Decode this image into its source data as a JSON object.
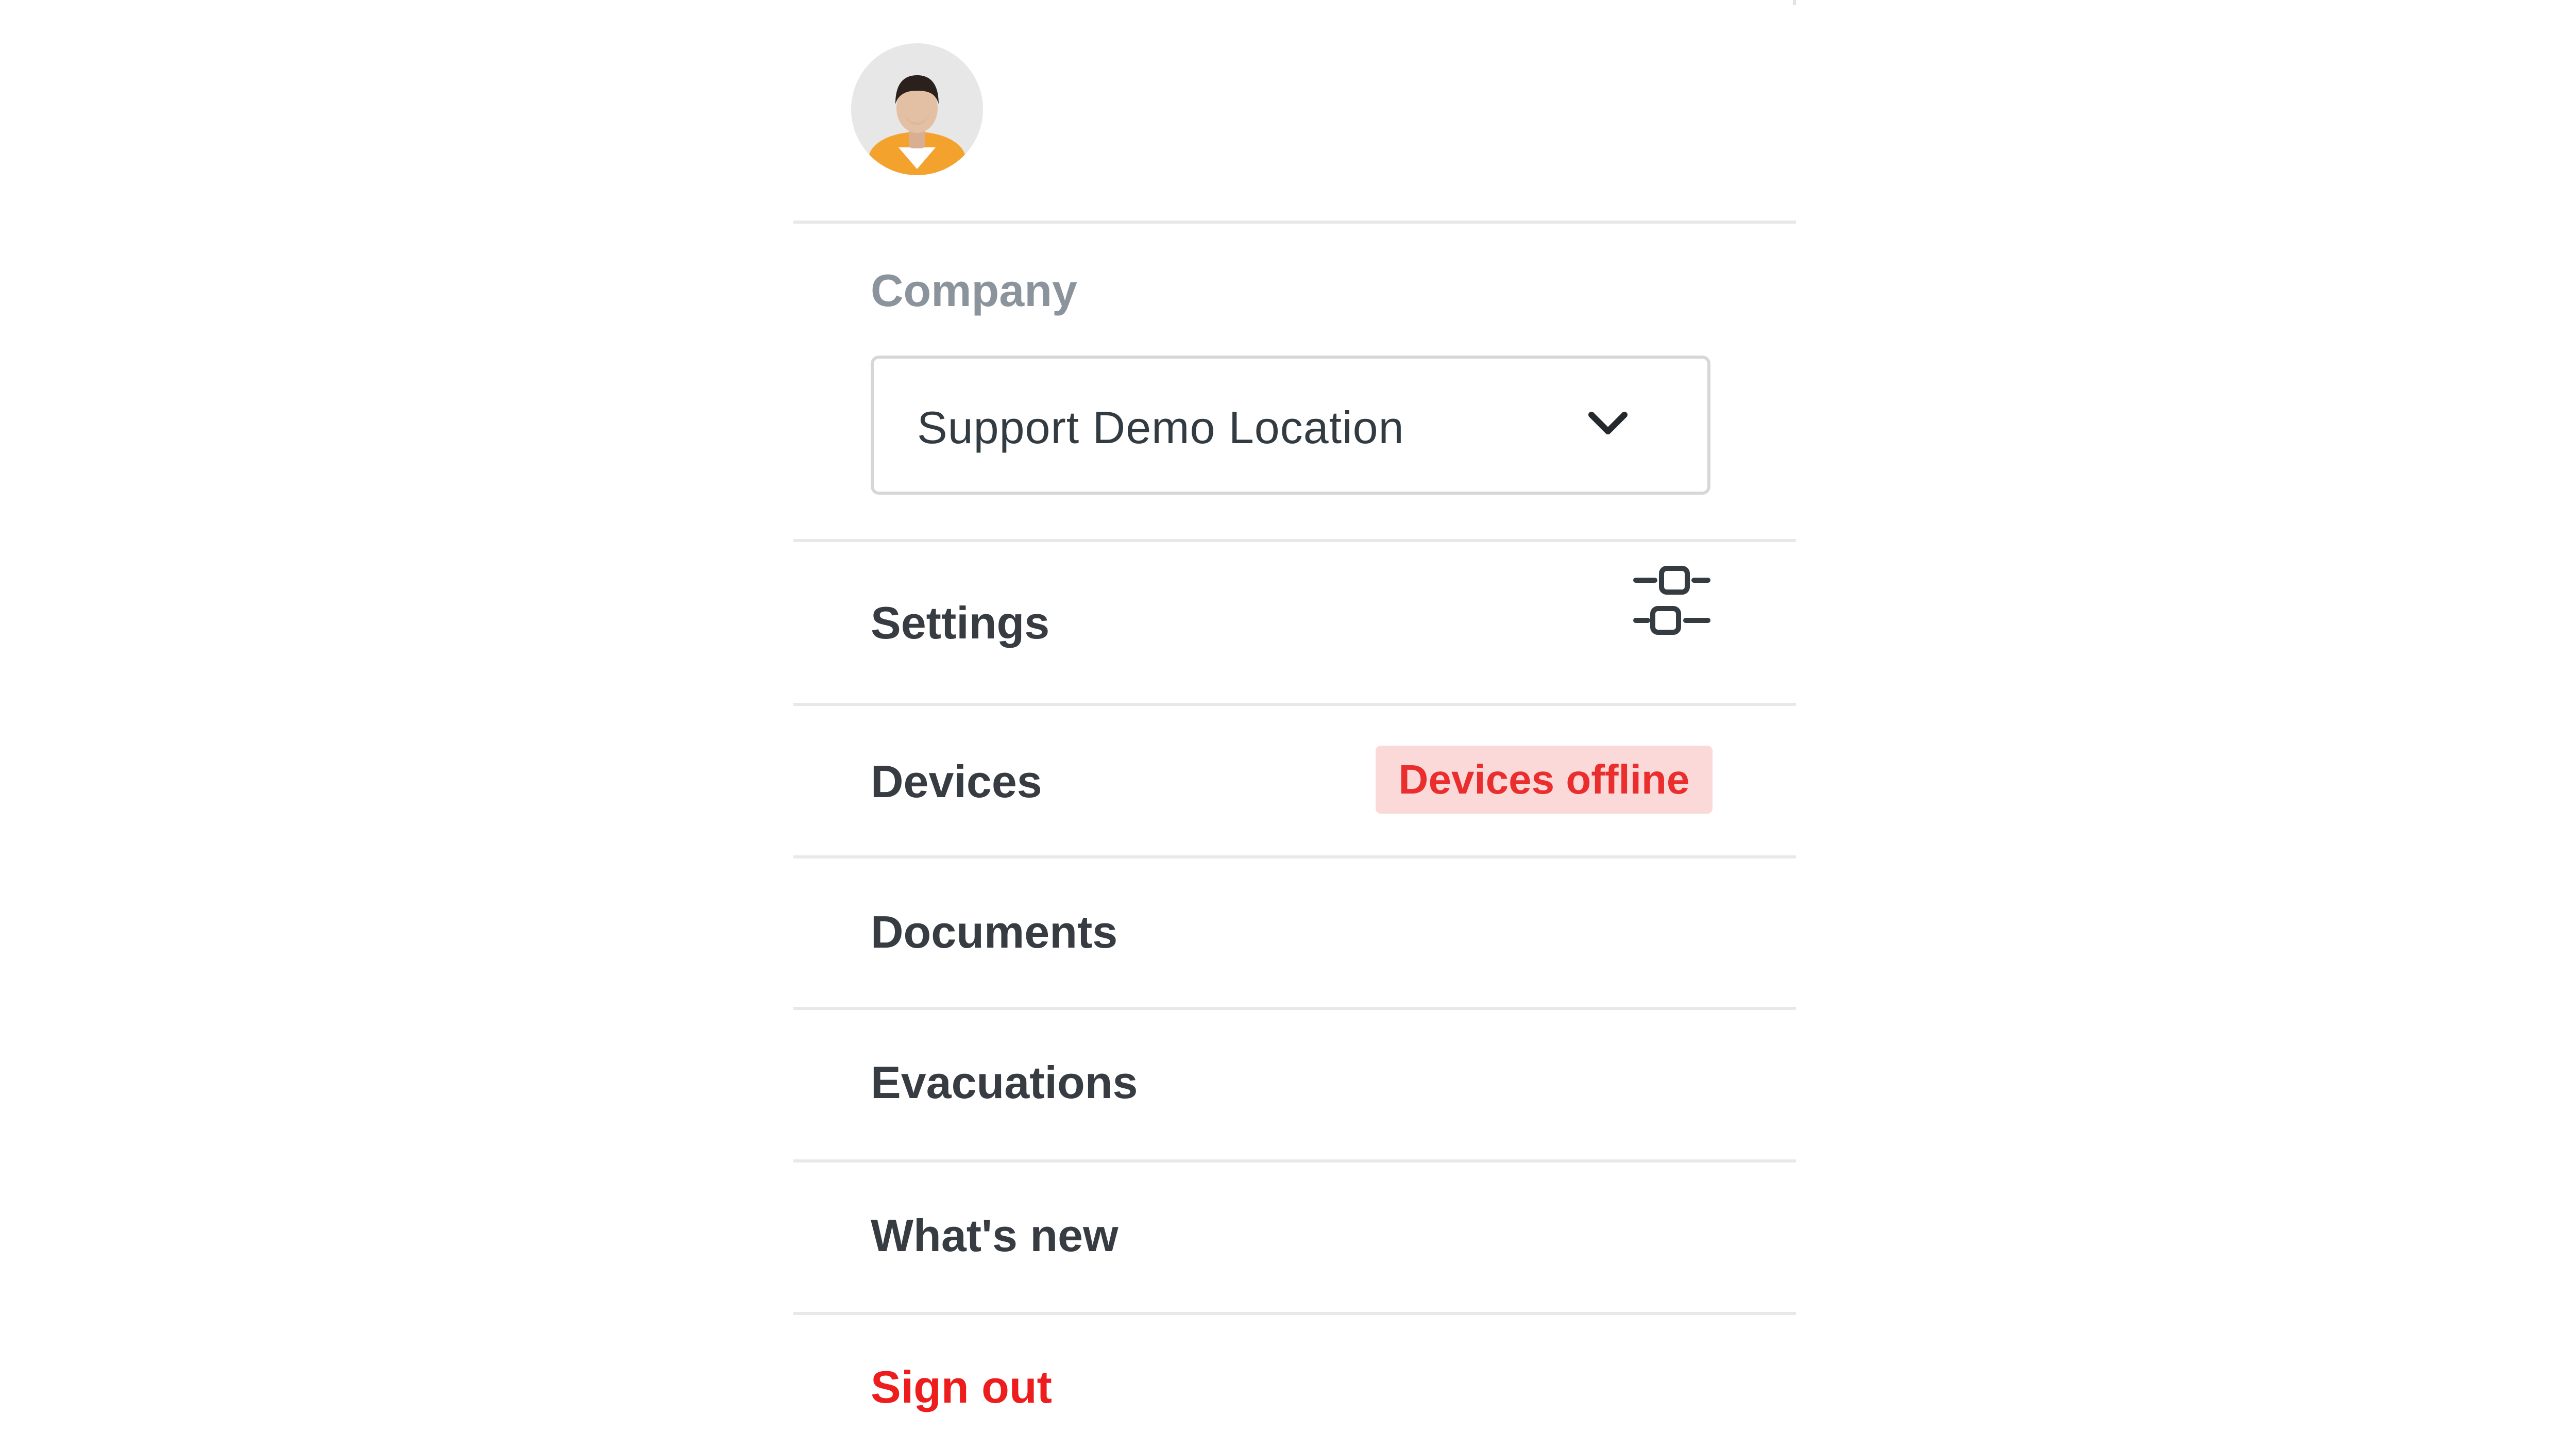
{
  "company": {
    "label": "Company",
    "selected": "Support Demo Location"
  },
  "menu": {
    "settings": "Settings",
    "devices": "Devices",
    "devices_badge": "Devices offline",
    "documents": "Documents",
    "evacuations": "Evacuations",
    "whats_new": "What's new",
    "sign_out": "Sign out"
  },
  "icons": {
    "avatar": "user-avatar-icon",
    "select": "chevron-down-icon",
    "settings": "sliders-icon"
  },
  "colors": {
    "danger": "#ee1d1d",
    "badge_background": "#fbd9d9",
    "badge_text": "#ea2d2d",
    "avatar_shirt": "#f2a22d",
    "muted_label": "#8b949c"
  }
}
